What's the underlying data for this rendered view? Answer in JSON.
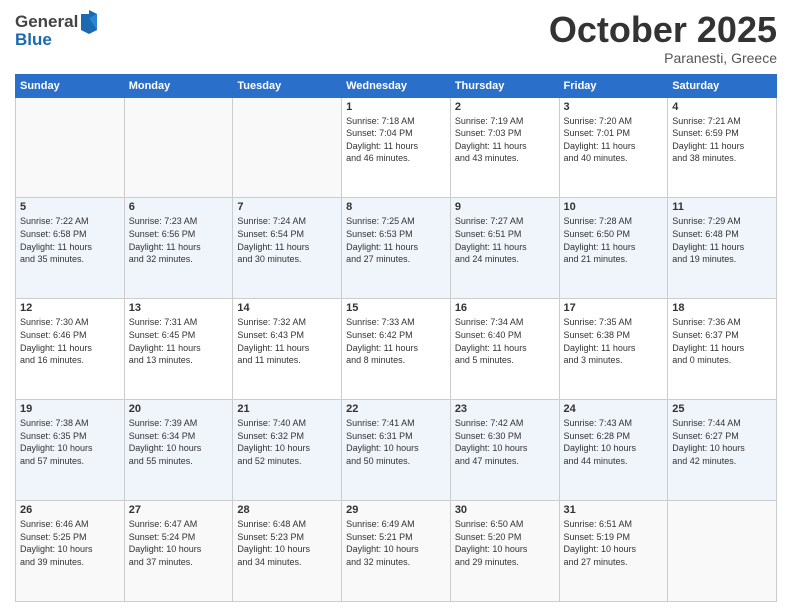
{
  "header": {
    "logo_line1": "General",
    "logo_line2": "Blue",
    "title": "October 2025",
    "subtitle": "Paranesti, Greece"
  },
  "weekdays": [
    "Sunday",
    "Monday",
    "Tuesday",
    "Wednesday",
    "Thursday",
    "Friday",
    "Saturday"
  ],
  "weeks": [
    {
      "days": [
        {
          "num": "",
          "info": ""
        },
        {
          "num": "",
          "info": ""
        },
        {
          "num": "",
          "info": ""
        },
        {
          "num": "1",
          "info": "Sunrise: 7:18 AM\nSunset: 7:04 PM\nDaylight: 11 hours\nand 46 minutes."
        },
        {
          "num": "2",
          "info": "Sunrise: 7:19 AM\nSunset: 7:03 PM\nDaylight: 11 hours\nand 43 minutes."
        },
        {
          "num": "3",
          "info": "Sunrise: 7:20 AM\nSunset: 7:01 PM\nDaylight: 11 hours\nand 40 minutes."
        },
        {
          "num": "4",
          "info": "Sunrise: 7:21 AM\nSunset: 6:59 PM\nDaylight: 11 hours\nand 38 minutes."
        }
      ]
    },
    {
      "days": [
        {
          "num": "5",
          "info": "Sunrise: 7:22 AM\nSunset: 6:58 PM\nDaylight: 11 hours\nand 35 minutes."
        },
        {
          "num": "6",
          "info": "Sunrise: 7:23 AM\nSunset: 6:56 PM\nDaylight: 11 hours\nand 32 minutes."
        },
        {
          "num": "7",
          "info": "Sunrise: 7:24 AM\nSunset: 6:54 PM\nDaylight: 11 hours\nand 30 minutes."
        },
        {
          "num": "8",
          "info": "Sunrise: 7:25 AM\nSunset: 6:53 PM\nDaylight: 11 hours\nand 27 minutes."
        },
        {
          "num": "9",
          "info": "Sunrise: 7:27 AM\nSunset: 6:51 PM\nDaylight: 11 hours\nand 24 minutes."
        },
        {
          "num": "10",
          "info": "Sunrise: 7:28 AM\nSunset: 6:50 PM\nDaylight: 11 hours\nand 21 minutes."
        },
        {
          "num": "11",
          "info": "Sunrise: 7:29 AM\nSunset: 6:48 PM\nDaylight: 11 hours\nand 19 minutes."
        }
      ]
    },
    {
      "days": [
        {
          "num": "12",
          "info": "Sunrise: 7:30 AM\nSunset: 6:46 PM\nDaylight: 11 hours\nand 16 minutes."
        },
        {
          "num": "13",
          "info": "Sunrise: 7:31 AM\nSunset: 6:45 PM\nDaylight: 11 hours\nand 13 minutes."
        },
        {
          "num": "14",
          "info": "Sunrise: 7:32 AM\nSunset: 6:43 PM\nDaylight: 11 hours\nand 11 minutes."
        },
        {
          "num": "15",
          "info": "Sunrise: 7:33 AM\nSunset: 6:42 PM\nDaylight: 11 hours\nand 8 minutes."
        },
        {
          "num": "16",
          "info": "Sunrise: 7:34 AM\nSunset: 6:40 PM\nDaylight: 11 hours\nand 5 minutes."
        },
        {
          "num": "17",
          "info": "Sunrise: 7:35 AM\nSunset: 6:38 PM\nDaylight: 11 hours\nand 3 minutes."
        },
        {
          "num": "18",
          "info": "Sunrise: 7:36 AM\nSunset: 6:37 PM\nDaylight: 11 hours\nand 0 minutes."
        }
      ]
    },
    {
      "days": [
        {
          "num": "19",
          "info": "Sunrise: 7:38 AM\nSunset: 6:35 PM\nDaylight: 10 hours\nand 57 minutes."
        },
        {
          "num": "20",
          "info": "Sunrise: 7:39 AM\nSunset: 6:34 PM\nDaylight: 10 hours\nand 55 minutes."
        },
        {
          "num": "21",
          "info": "Sunrise: 7:40 AM\nSunset: 6:32 PM\nDaylight: 10 hours\nand 52 minutes."
        },
        {
          "num": "22",
          "info": "Sunrise: 7:41 AM\nSunset: 6:31 PM\nDaylight: 10 hours\nand 50 minutes."
        },
        {
          "num": "23",
          "info": "Sunrise: 7:42 AM\nSunset: 6:30 PM\nDaylight: 10 hours\nand 47 minutes."
        },
        {
          "num": "24",
          "info": "Sunrise: 7:43 AM\nSunset: 6:28 PM\nDaylight: 10 hours\nand 44 minutes."
        },
        {
          "num": "25",
          "info": "Sunrise: 7:44 AM\nSunset: 6:27 PM\nDaylight: 10 hours\nand 42 minutes."
        }
      ]
    },
    {
      "days": [
        {
          "num": "26",
          "info": "Sunrise: 6:46 AM\nSunset: 5:25 PM\nDaylight: 10 hours\nand 39 minutes."
        },
        {
          "num": "27",
          "info": "Sunrise: 6:47 AM\nSunset: 5:24 PM\nDaylight: 10 hours\nand 37 minutes."
        },
        {
          "num": "28",
          "info": "Sunrise: 6:48 AM\nSunset: 5:23 PM\nDaylight: 10 hours\nand 34 minutes."
        },
        {
          "num": "29",
          "info": "Sunrise: 6:49 AM\nSunset: 5:21 PM\nDaylight: 10 hours\nand 32 minutes."
        },
        {
          "num": "30",
          "info": "Sunrise: 6:50 AM\nSunset: 5:20 PM\nDaylight: 10 hours\nand 29 minutes."
        },
        {
          "num": "31",
          "info": "Sunrise: 6:51 AM\nSunset: 5:19 PM\nDaylight: 10 hours\nand 27 minutes."
        },
        {
          "num": "",
          "info": ""
        }
      ]
    }
  ]
}
